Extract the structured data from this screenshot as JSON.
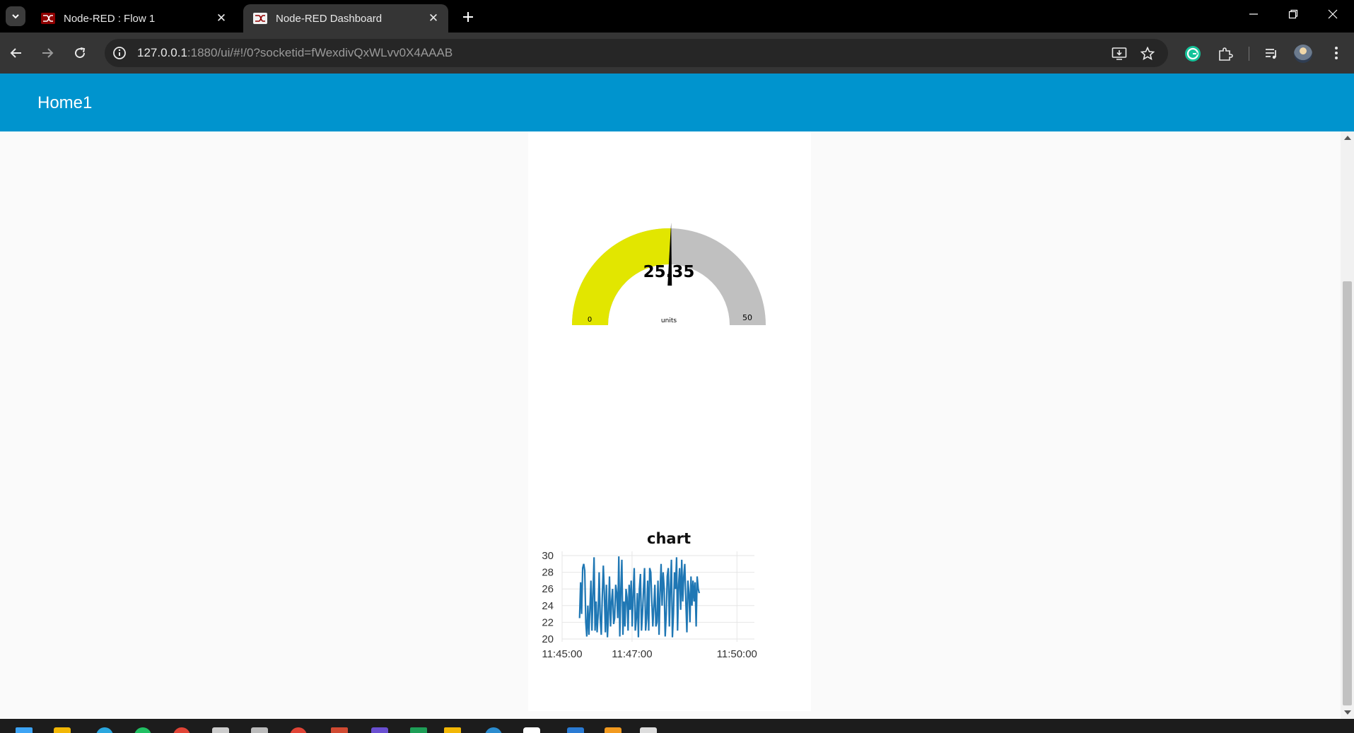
{
  "browser": {
    "tabs": [
      {
        "title": "Node-RED : Flow 1",
        "active": false
      },
      {
        "title": "Node-RED Dashboard",
        "active": true
      }
    ],
    "url_host": "127.0.0.1",
    "url_rest": ":1880/ui/#!/0?socketid=fWexdivQxWLvv0X4AAAB"
  },
  "page": {
    "title": "Home1",
    "header_color": "#0094ce"
  },
  "gauge": {
    "value": 25.35,
    "value_text": "25.35",
    "units": "units",
    "min": 0,
    "max": 50,
    "min_label": "0",
    "max_label": "50",
    "fill_color": "#e2e600",
    "track_color": "#c0c0c0"
  },
  "chart_data": {
    "type": "line",
    "title": "chart",
    "ylim": [
      20,
      30
    ],
    "yticks": [
      "30",
      "28",
      "26",
      "24",
      "22",
      "20"
    ],
    "xticks": [
      {
        "label": "11:45:00",
        "t": 0
      },
      {
        "label": "11:47:00",
        "t": 120
      },
      {
        "label": "11:50:00",
        "t": 300
      }
    ],
    "xlim_seconds": [
      0,
      330
    ],
    "grid": true,
    "series": [
      {
        "color": "#1f77b4",
        "start_seconds": 30,
        "step_seconds": 1.77,
        "values": [
          22.5,
          26.8,
          23.0,
          28.5,
          29.0,
          28.2,
          22.0,
          20.3,
          24.0,
          20.5,
          23.5,
          27.0,
          21.0,
          25.5,
          29.8,
          21.0,
          24.5,
          20.8,
          23.0,
          28.0,
          22.5,
          20.5,
          25.0,
          28.8,
          25.5,
          20.8,
          26.5,
          20.2,
          23.0,
          27.5,
          21.5,
          24.5,
          26.0,
          21.8,
          22.5,
          26.5,
          25.5,
          22.5,
          29.9,
          20.3,
          26.0,
          29.5,
          20.5,
          24.5,
          21.5,
          26.0,
          25.0,
          21.0,
          26.5,
          23.5,
          27.0,
          21.5,
          25.5,
          28.5,
          21.0,
          22.5,
          25.5,
          20.2,
          26.0,
          27.8,
          21.0,
          23.0,
          26.0,
          28.5,
          21.0,
          22.5,
          27.0,
          21.0,
          28.5,
          28.0,
          24.5,
          21.5,
          24.0,
          26.5,
          21.5,
          22.0,
          27.0,
          20.5,
          25.5,
          29.0,
          24.0,
          28.0,
          26.0,
          20.3,
          23.0,
          27.5,
          28.5,
          21.5,
          26.0,
          29.5,
          20.2,
          23.0,
          28.0,
          26.0,
          29.8,
          21.0,
          26.5,
          28.5,
          23.5,
          29.5,
          24.5,
          27.5,
          29.0,
          24.5,
          20.8,
          27.0,
          25.5,
          22.0,
          27.5,
          24.0,
          27.0,
          24.5,
          26.8,
          21.5,
          27.5,
          26.0,
          25.5
        ]
      }
    ]
  }
}
